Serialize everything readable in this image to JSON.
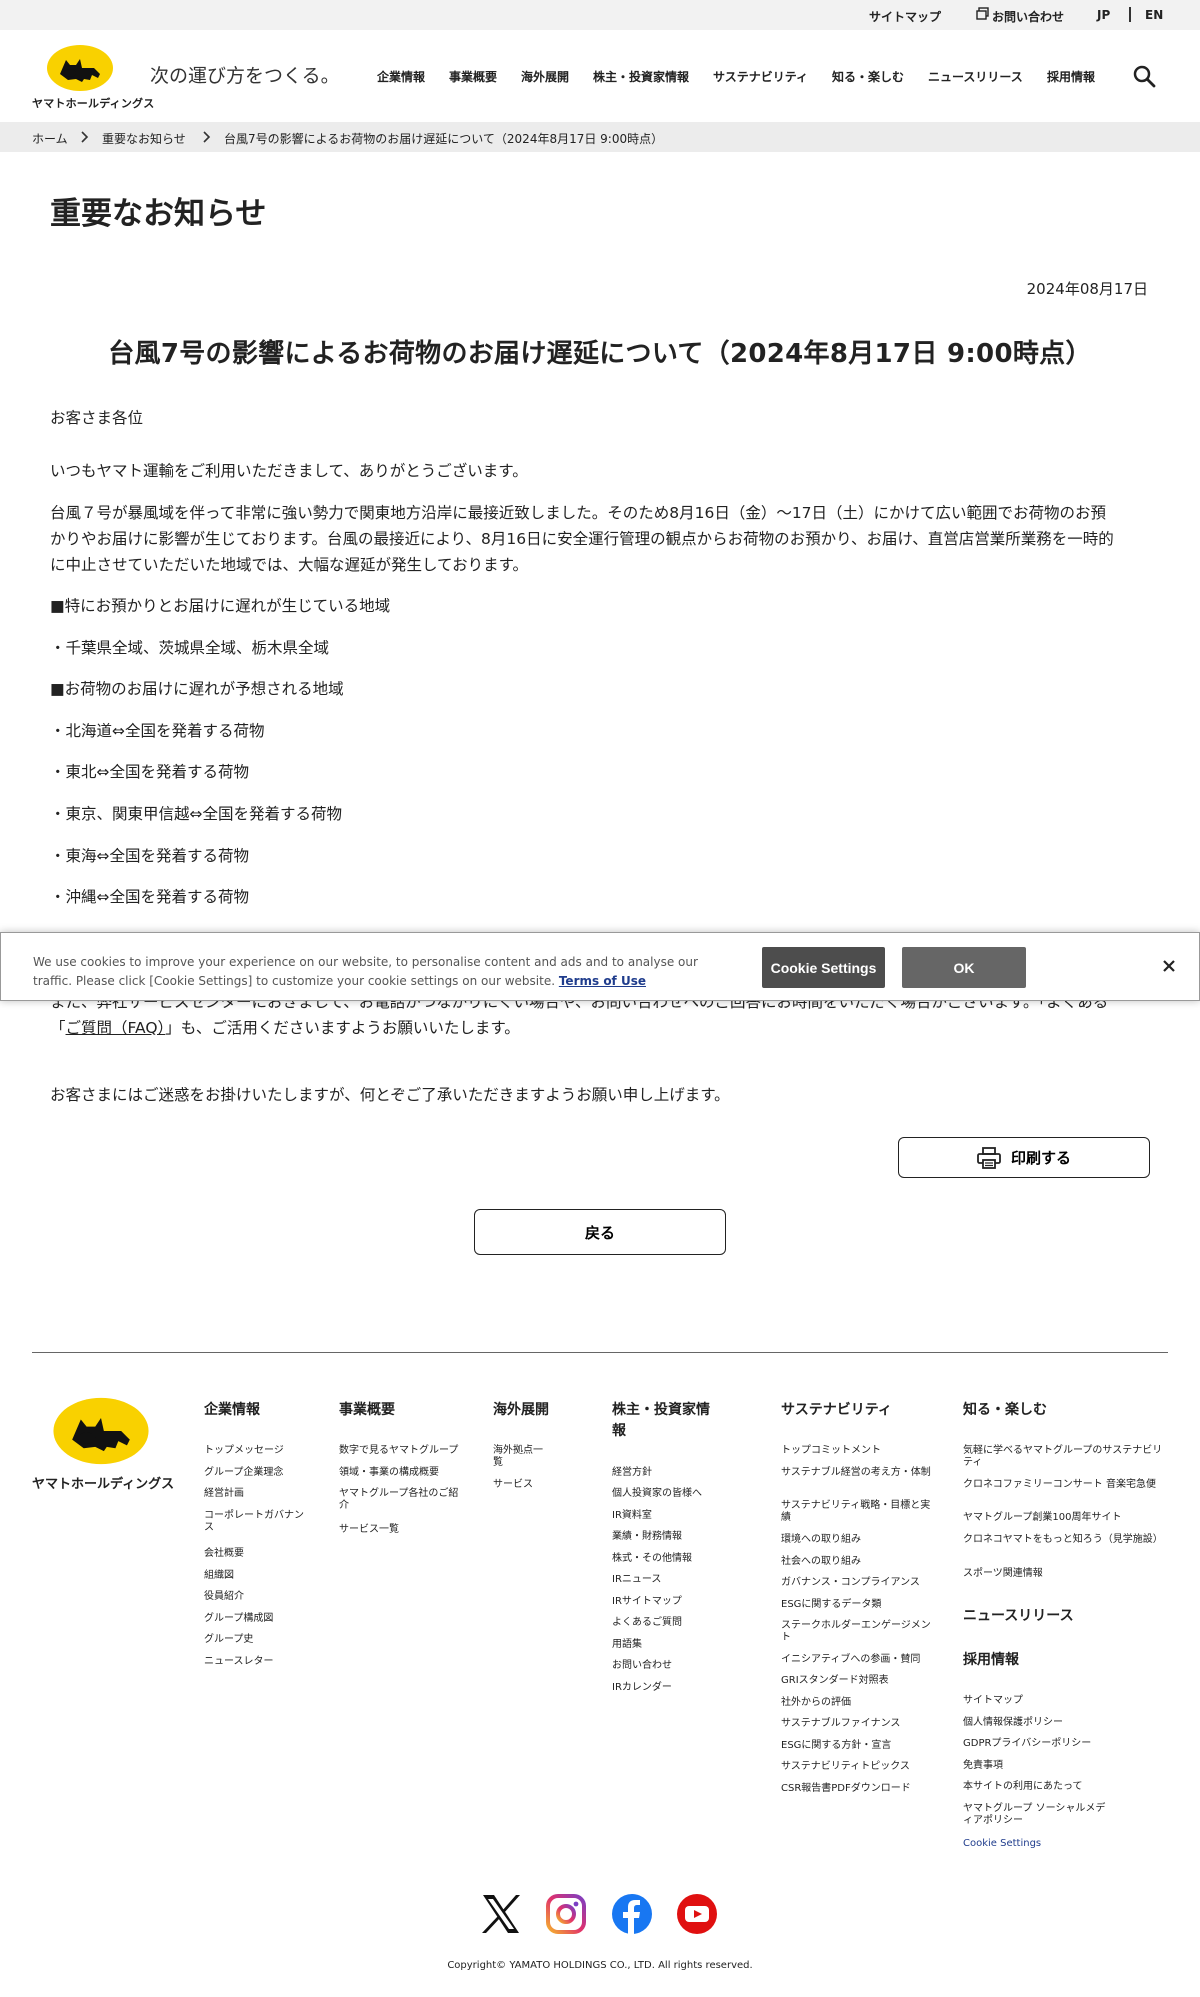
{
  "utility": {
    "sitemap": "サイトマップ",
    "contact": "お問い合わせ",
    "jp": "JP",
    "en": "EN"
  },
  "header": {
    "logo_text": "ヤマトホールディングス",
    "tagline": "次の運び方をつくる。",
    "nav": [
      "企業情報",
      "事業概要",
      "海外展開",
      "株主・投資家情報",
      "サステナビリティ",
      "知る・楽しむ",
      "ニュースリリース",
      "採用情報"
    ]
  },
  "breadcrumb": [
    "ホーム",
    "重要なお知らせ",
    "台風7号の影響によるお荷物のお届け遅延について（2024年8月17日 9:00時点）"
  ],
  "page_title": "重要なお知らせ",
  "article": {
    "date": "2024年08月17日",
    "title": "台風7号の影響によるお荷物のお届け遅延について（2024年8月17日 9:00時点）",
    "greeting": "お客さま各位",
    "p1": "いつもヤマト運輸をご利用いただきまして、ありがとうございます。",
    "p2_l1": "台風７号が暴風域を伴って非常に強い勢力で関東地方沿岸に最接近致しました。そのため8月16日（金）～17日（土）にかけて広い範囲でお荷物のお預",
    "p2_l2": "かりやお届けに影響が生じております。台風の最接近により、8月16日に安全運行管理の観点からお荷物のお預かり、お届け、直営店営業所業務を一時的",
    "p2_l3": "に中止させていただいた地域では、大幅な遅延が発生しております。",
    "h_delay": "■特にお預かりとお届けに遅れが生じている地域",
    "delay_area": "・千葉県全域、茨城県全域、栃木県全域",
    "h_expected": "■お荷物のお届けに遅れが予想される地域",
    "expected": [
      "・北海道⇔全国を発着する荷物",
      "・東北⇔全国を発着する荷物",
      "・東京、関東甲信越⇔全国を発着する荷物",
      "・東海⇔全国を発着する荷物",
      "・沖縄⇔全国を発着する荷物"
    ],
    "p3_l1": "また、弊社サービスセンターにおきまして、お電話がつながりにくい場合や、お問い合わせへのご回答にお時間をいただく場合がございます。「よくある",
    "p3_l2_link": "ご質問（FAQ）",
    "p3_l2_rest": "」も、ご活用くださいますようお願いいたします。",
    "closing": "お客さまにはご迷惑をお掛けいたしますが、何とぞご了承いただきますようお願い申し上げます。",
    "print_label": "印刷する",
    "back_label": "戻る"
  },
  "footer": {
    "logo_text": "ヤマトホールディングス",
    "columns": [
      {
        "heading": "企業情報",
        "items": [
          "トップメッセージ",
          "グループ企業理念",
          "経営計画",
          "コーポレートガバナンス",
          "会社概要",
          "組織図",
          "役員紹介",
          "グループ構成図",
          "グループ史",
          "ニュースレター"
        ]
      },
      {
        "heading": "事業概要",
        "items": [
          "数字で見るヤマトグループ",
          "領域・事業の構成概要",
          "ヤマトグループ各社のご紹介",
          "サービス一覧"
        ]
      },
      {
        "heading": "海外展開",
        "items": [
          "海外拠点一覧",
          "サービス"
        ]
      },
      {
        "heading": "株主・投資家情報",
        "items": [
          "経営方針",
          "個人投資家の皆様へ",
          "IR資料室",
          "業績・財務情報",
          "株式・その他情報",
          "IRニュース",
          "IRサイトマップ",
          "よくあるご質問",
          "用語集",
          "お問い合わせ",
          "IRカレンダー"
        ]
      },
      {
        "heading": "サステナビリティ",
        "items": [
          "トップコミットメント",
          "サステナブル経営の考え方・体制",
          "サステナビリティ戦略・目標と実績",
          "環境への取り組み",
          "社会への取り組み",
          "ガバナンス・コンプライアンス",
          "ESGに関するデータ類",
          "ステークホルダーエンゲージメント",
          "イニシアティブへの参画・賛同",
          "GRIスタンダード対照表",
          "社外からの評価",
          "サステナブルファイナンス",
          "ESGに関する方針・宣言",
          "サステナビリティトピックス",
          "CSR報告書PDFダウンロード"
        ]
      },
      {
        "heading": "知る・楽しむ",
        "items": [
          "気軽に学べるヤマトグループのサステナビリティ",
          "クロネコファミリーコンサート 音楽宅急便",
          "ヤマトグループ創業100周年サイト",
          "クロネコヤマトをもっと知ろう（見学施設）",
          "スポーツ関連情報"
        ]
      }
    ],
    "extra_headings": [
      "ニュースリリース",
      "採用情報"
    ],
    "misc_links": [
      "サイトマップ",
      "個人情報保護ポリシー",
      "GDPRプライバシーポリシー",
      "免責事項",
      "本サイトの利用にあたって",
      "ヤマトグループ ソーシャルメディアポリシー"
    ],
    "cookie_settings_link": "Cookie Settings",
    "copyright": "Copyright© YAMATO HOLDINGS CO., LTD. All rights reserved."
  },
  "cookie_banner": {
    "message_l1": "We use cookies to improve your experience on our website, to personalise content and ads and to analyse our",
    "message_l2": "traffic. Please click [Cookie Settings] to customize your cookie settings on our website.",
    "terms_link": "Terms of Use",
    "settings_button": "Cookie Settings",
    "ok_button": "OK"
  },
  "colors": {
    "brand_yellow": "#f9d100",
    "cookie_settings_bg": "#4d4d4d",
    "cookie_ok_bg": "#666666",
    "link_blue": "#1f3c8c"
  },
  "icons": {
    "search": "search-icon",
    "contact": "window-icon",
    "print": "printer-icon",
    "x": "x-logo-icon",
    "instagram": "instagram-icon",
    "facebook": "facebook-icon",
    "youtube": "youtube-icon",
    "close": "close-icon"
  }
}
